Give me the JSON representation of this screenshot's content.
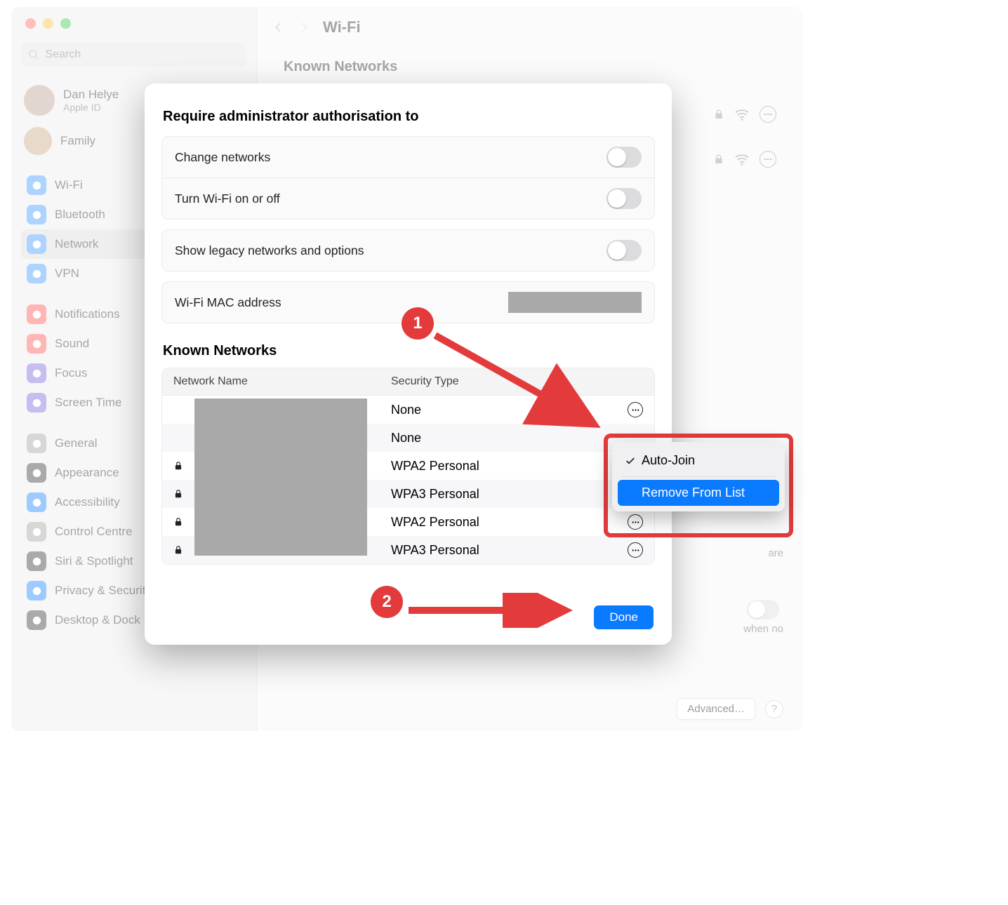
{
  "window": {
    "search_placeholder": "Search",
    "user": {
      "name": "Dan Helye",
      "sub": "Apple ID"
    },
    "family_label": "Family",
    "title": "Wi-Fi",
    "known_bg_header": "Known Networks",
    "advanced_button": "Advanced…",
    "text_are": "are",
    "text_whenno": "when no"
  },
  "sidebar": {
    "items": [
      {
        "label": "Wi-Fi",
        "color": "#3395ff"
      },
      {
        "label": "Bluetooth",
        "color": "#3395ff"
      },
      {
        "label": "Network",
        "color": "#3395ff",
        "selected": true
      },
      {
        "label": "VPN",
        "color": "#3395ff"
      }
    ],
    "group2": [
      {
        "label": "Notifications",
        "color": "#ff4a47"
      },
      {
        "label": "Sound",
        "color": "#ff4a47"
      },
      {
        "label": "Focus",
        "color": "#6f5dd8"
      },
      {
        "label": "Screen Time",
        "color": "#6f5dd8"
      }
    ],
    "group3": [
      {
        "label": "General",
        "color": "#9b9b9e"
      },
      {
        "label": "Appearance",
        "color": "#2b2b2d"
      },
      {
        "label": "Accessibility",
        "color": "#0a7aff"
      },
      {
        "label": "Control Centre",
        "color": "#9b9b9e"
      },
      {
        "label": "Siri & Spotlight",
        "color": "#2b2b2d"
      },
      {
        "label": "Privacy & Security",
        "color": "#0a7aff"
      },
      {
        "label": "Desktop & Dock",
        "color": "#2b2b2d"
      }
    ]
  },
  "sheet": {
    "heading": "Require administrator authorisation to",
    "rows": {
      "change_networks": "Change networks",
      "turn_wifi": "Turn Wi-Fi on or off",
      "legacy": "Show legacy networks and options",
      "mac": "Wi-Fi MAC address"
    },
    "known_heading": "Known Networks",
    "columns": {
      "name": "Network Name",
      "security": "Security Type"
    },
    "networks": [
      {
        "locked": false,
        "security": "None"
      },
      {
        "locked": false,
        "security": "None"
      },
      {
        "locked": true,
        "security": "WPA2 Personal"
      },
      {
        "locked": true,
        "security": "WPA3 Personal"
      },
      {
        "locked": true,
        "security": "WPA2 Personal"
      },
      {
        "locked": true,
        "security": "WPA3 Personal"
      }
    ],
    "done": "Done"
  },
  "popup": {
    "auto_join": "Auto-Join",
    "remove": "Remove From List"
  },
  "annotations": {
    "step1": "1",
    "step2": "2"
  }
}
